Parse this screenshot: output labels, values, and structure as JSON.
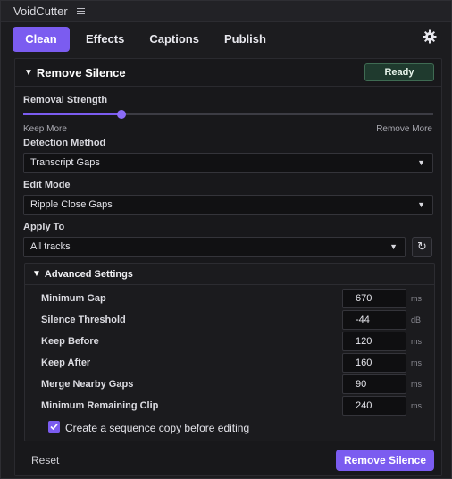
{
  "app": {
    "title": "VoidCutter"
  },
  "tabs": [
    {
      "label": "Clean"
    },
    {
      "label": "Effects"
    },
    {
      "label": "Captions"
    },
    {
      "label": "Publish"
    }
  ],
  "section": {
    "title": "Remove Silence",
    "status": "Ready"
  },
  "removal_strength": {
    "label": "Removal Strength",
    "min_label": "Keep More",
    "max_label": "Remove More",
    "value_fraction": 0.24
  },
  "detection_method": {
    "label": "Detection Method",
    "value": "Transcript Gaps"
  },
  "edit_mode": {
    "label": "Edit Mode",
    "value": "Ripple Close Gaps"
  },
  "apply_to": {
    "label": "Apply To",
    "value": "All tracks"
  },
  "advanced": {
    "title": "Advanced Settings",
    "rows": [
      {
        "label": "Minimum Gap",
        "value": "670",
        "unit": "ms"
      },
      {
        "label": "Silence Threshold",
        "value": "-44",
        "unit": "dB"
      },
      {
        "label": "Keep Before",
        "value": "120",
        "unit": "ms"
      },
      {
        "label": "Keep After",
        "value": "160",
        "unit": "ms"
      },
      {
        "label": "Merge Nearby Gaps",
        "value": "90",
        "unit": "ms"
      },
      {
        "label": "Minimum Remaining Clip",
        "value": "240",
        "unit": "ms"
      }
    ],
    "checkbox_label": "Create a sequence copy before editing",
    "checkbox_checked": true
  },
  "footer": {
    "reset_label": "Reset",
    "primary_label": "Remove Silence"
  },
  "colors": {
    "accent": "#7b5cf0",
    "ready_bg": "#1f3a2e"
  }
}
